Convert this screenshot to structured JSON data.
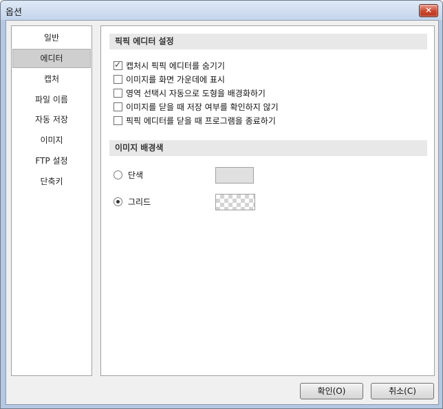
{
  "window": {
    "title": "옵션",
    "close_glyph": "✕"
  },
  "sidebar": {
    "items": [
      {
        "label": "일반"
      },
      {
        "label": "에디터",
        "selected": true
      },
      {
        "label": "캡처"
      },
      {
        "label": "파일 이름"
      },
      {
        "label": "자동 저장"
      },
      {
        "label": "이미지"
      },
      {
        "label": "FTP 설정"
      },
      {
        "label": "단축키"
      }
    ]
  },
  "editor_settings": {
    "header": "픽픽 에디터 설정",
    "options": [
      {
        "label": "캡처시 픽픽 에디터를 숨기기",
        "checked": true
      },
      {
        "label": "이미지를 화면 가운데에 표시",
        "checked": false
      },
      {
        "label": "영역 선택시 자동으로 도형을 배경화하기",
        "checked": false
      },
      {
        "label": "이미지를 닫을 때 저장 여부를 확인하지 않기",
        "checked": false
      },
      {
        "label": "픽픽 에디터를 닫을 때 프로그램을 종료하기",
        "checked": false
      }
    ]
  },
  "background": {
    "header": "이미지 배경색",
    "options": [
      {
        "label": "단색",
        "selected": false
      },
      {
        "label": "그리드",
        "selected": true
      }
    ],
    "solid_color": "#e0e0e0"
  },
  "buttons": {
    "ok": "확인(O)",
    "cancel": "취소(C)"
  },
  "colors": {
    "selected_item": "#cfcfcf",
    "section_header": "#e8e8e8",
    "close_button": "#c9472d"
  }
}
